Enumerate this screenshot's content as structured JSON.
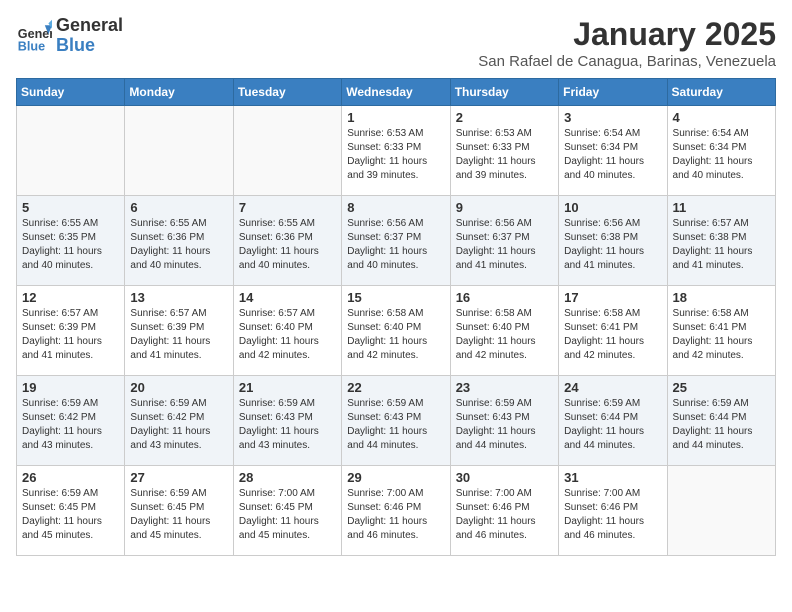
{
  "header": {
    "logo_line1": "General",
    "logo_line2": "Blue",
    "month_title": "January 2025",
    "location": "San Rafael de Canagua, Barinas, Venezuela"
  },
  "weekdays": [
    "Sunday",
    "Monday",
    "Tuesday",
    "Wednesday",
    "Thursday",
    "Friday",
    "Saturday"
  ],
  "weeks": [
    [
      {
        "day": "",
        "text": ""
      },
      {
        "day": "",
        "text": ""
      },
      {
        "day": "",
        "text": ""
      },
      {
        "day": "1",
        "text": "Sunrise: 6:53 AM\nSunset: 6:33 PM\nDaylight: 11 hours and 39 minutes."
      },
      {
        "day": "2",
        "text": "Sunrise: 6:53 AM\nSunset: 6:33 PM\nDaylight: 11 hours and 39 minutes."
      },
      {
        "day": "3",
        "text": "Sunrise: 6:54 AM\nSunset: 6:34 PM\nDaylight: 11 hours and 40 minutes."
      },
      {
        "day": "4",
        "text": "Sunrise: 6:54 AM\nSunset: 6:34 PM\nDaylight: 11 hours and 40 minutes."
      }
    ],
    [
      {
        "day": "5",
        "text": "Sunrise: 6:55 AM\nSunset: 6:35 PM\nDaylight: 11 hours and 40 minutes."
      },
      {
        "day": "6",
        "text": "Sunrise: 6:55 AM\nSunset: 6:36 PM\nDaylight: 11 hours and 40 minutes."
      },
      {
        "day": "7",
        "text": "Sunrise: 6:55 AM\nSunset: 6:36 PM\nDaylight: 11 hours and 40 minutes."
      },
      {
        "day": "8",
        "text": "Sunrise: 6:56 AM\nSunset: 6:37 PM\nDaylight: 11 hours and 40 minutes."
      },
      {
        "day": "9",
        "text": "Sunrise: 6:56 AM\nSunset: 6:37 PM\nDaylight: 11 hours and 41 minutes."
      },
      {
        "day": "10",
        "text": "Sunrise: 6:56 AM\nSunset: 6:38 PM\nDaylight: 11 hours and 41 minutes."
      },
      {
        "day": "11",
        "text": "Sunrise: 6:57 AM\nSunset: 6:38 PM\nDaylight: 11 hours and 41 minutes."
      }
    ],
    [
      {
        "day": "12",
        "text": "Sunrise: 6:57 AM\nSunset: 6:39 PM\nDaylight: 11 hours and 41 minutes."
      },
      {
        "day": "13",
        "text": "Sunrise: 6:57 AM\nSunset: 6:39 PM\nDaylight: 11 hours and 41 minutes."
      },
      {
        "day": "14",
        "text": "Sunrise: 6:57 AM\nSunset: 6:40 PM\nDaylight: 11 hours and 42 minutes."
      },
      {
        "day": "15",
        "text": "Sunrise: 6:58 AM\nSunset: 6:40 PM\nDaylight: 11 hours and 42 minutes."
      },
      {
        "day": "16",
        "text": "Sunrise: 6:58 AM\nSunset: 6:40 PM\nDaylight: 11 hours and 42 minutes."
      },
      {
        "day": "17",
        "text": "Sunrise: 6:58 AM\nSunset: 6:41 PM\nDaylight: 11 hours and 42 minutes."
      },
      {
        "day": "18",
        "text": "Sunrise: 6:58 AM\nSunset: 6:41 PM\nDaylight: 11 hours and 42 minutes."
      }
    ],
    [
      {
        "day": "19",
        "text": "Sunrise: 6:59 AM\nSunset: 6:42 PM\nDaylight: 11 hours and 43 minutes."
      },
      {
        "day": "20",
        "text": "Sunrise: 6:59 AM\nSunset: 6:42 PM\nDaylight: 11 hours and 43 minutes."
      },
      {
        "day": "21",
        "text": "Sunrise: 6:59 AM\nSunset: 6:43 PM\nDaylight: 11 hours and 43 minutes."
      },
      {
        "day": "22",
        "text": "Sunrise: 6:59 AM\nSunset: 6:43 PM\nDaylight: 11 hours and 44 minutes."
      },
      {
        "day": "23",
        "text": "Sunrise: 6:59 AM\nSunset: 6:43 PM\nDaylight: 11 hours and 44 minutes."
      },
      {
        "day": "24",
        "text": "Sunrise: 6:59 AM\nSunset: 6:44 PM\nDaylight: 11 hours and 44 minutes."
      },
      {
        "day": "25",
        "text": "Sunrise: 6:59 AM\nSunset: 6:44 PM\nDaylight: 11 hours and 44 minutes."
      }
    ],
    [
      {
        "day": "26",
        "text": "Sunrise: 6:59 AM\nSunset: 6:45 PM\nDaylight: 11 hours and 45 minutes."
      },
      {
        "day": "27",
        "text": "Sunrise: 6:59 AM\nSunset: 6:45 PM\nDaylight: 11 hours and 45 minutes."
      },
      {
        "day": "28",
        "text": "Sunrise: 7:00 AM\nSunset: 6:45 PM\nDaylight: 11 hours and 45 minutes."
      },
      {
        "day": "29",
        "text": "Sunrise: 7:00 AM\nSunset: 6:46 PM\nDaylight: 11 hours and 46 minutes."
      },
      {
        "day": "30",
        "text": "Sunrise: 7:00 AM\nSunset: 6:46 PM\nDaylight: 11 hours and 46 minutes."
      },
      {
        "day": "31",
        "text": "Sunrise: 7:00 AM\nSunset: 6:46 PM\nDaylight: 11 hours and 46 minutes."
      },
      {
        "day": "",
        "text": ""
      }
    ]
  ]
}
